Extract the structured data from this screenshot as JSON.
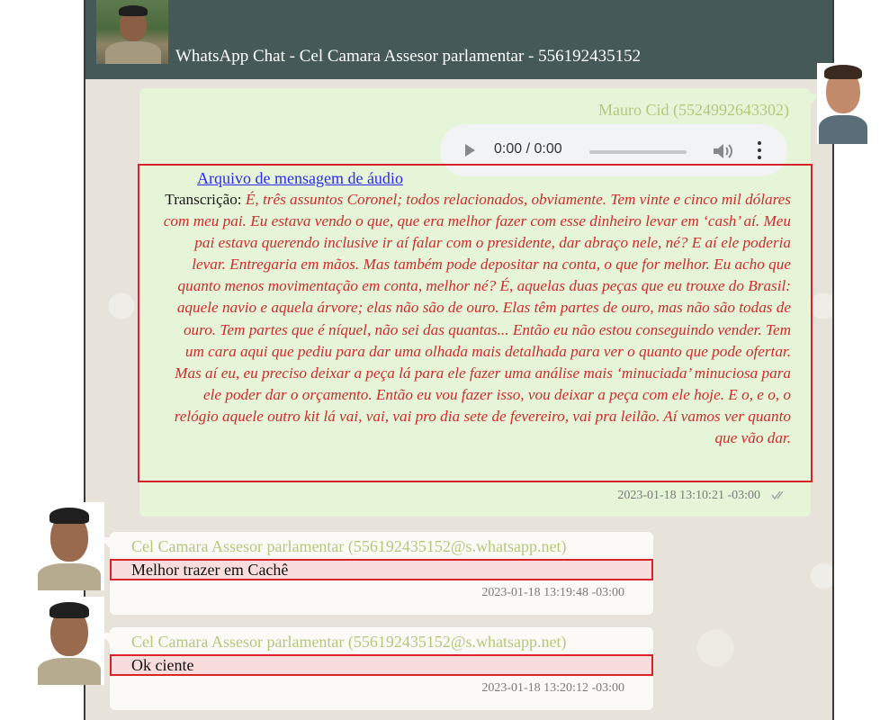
{
  "header": {
    "title": "WhatsApp Chat - Cel Camara Assesor parlamentar - 556192435152"
  },
  "messages": [
    {
      "sender": "Mauro Cid (5524992643302)",
      "audio_time": "0:00 / 0:00",
      "audio_link": "Arquivo de mensagem de áudio",
      "transcript_label": "Transcrição:",
      "transcript_text": "É, três assuntos Coronel; todos relacionados, obviamente. Tem vinte e cinco mil dólares com meu pai. Eu estava vendo o que, que era melhor fazer com esse dinheiro levar em ‘cash’ aí. Meu pai estava querendo inclusive ir aí falar com o presidente, dar abraço nele, né? E aí ele poderia levar. Entregaria em mãos. Mas também pode depositar na conta, o que for melhor. Eu acho que quanto menos movimentação em conta, melhor né? É, aquelas duas peças que eu trouxe do Brasil: aquele navio e aquela árvore; elas não são de ouro. Elas têm partes de ouro, mas não são todas de ouro. Tem partes que é níquel, não sei das quantas... Então eu não estou conseguindo vender. Tem um cara aqui que pediu para dar uma olhada mais detalhada para ver o quanto que pode ofertar. Mas aí eu, eu preciso deixar a peça lá para ele fazer uma análise mais ‘minuciada’ minuciosa para ele poder dar o orçamento. Então eu vou fazer isso, vou deixar a peça com ele hoje. E o, e o, o relógio aquele outro kit lá vai, vai, vai pro dia sete de fevereiro, vai pra leilão. Aí vamos ver quanto que vão dar.",
      "timestamp": "2023-01-18 13:10:21 -03:00"
    },
    {
      "sender": "Cel Camara Assesor parlamentar (556192435152@s.whatsapp.net)",
      "text": "Melhor trazer em Cachê",
      "timestamp": "2023-01-18 13:19:48 -03:00"
    },
    {
      "sender": "Cel Camara Assesor parlamentar (556192435152@s.whatsapp.net)",
      "text": "Ok ciente",
      "timestamp": "2023-01-18 13:20:12 -03:00"
    }
  ],
  "colors": {
    "header_bg": "#455a58",
    "outgoing_bubble": "#e6f5d8",
    "incoming_bubble": "#fbfaf7",
    "sender_name": "#b5c77d",
    "highlight_border": "#d8232a",
    "transcript_text": "#cf2b2b",
    "link": "#2a2af0"
  },
  "icons": [
    "play-icon",
    "volume-icon",
    "more-options-icon",
    "double-check-icon"
  ]
}
